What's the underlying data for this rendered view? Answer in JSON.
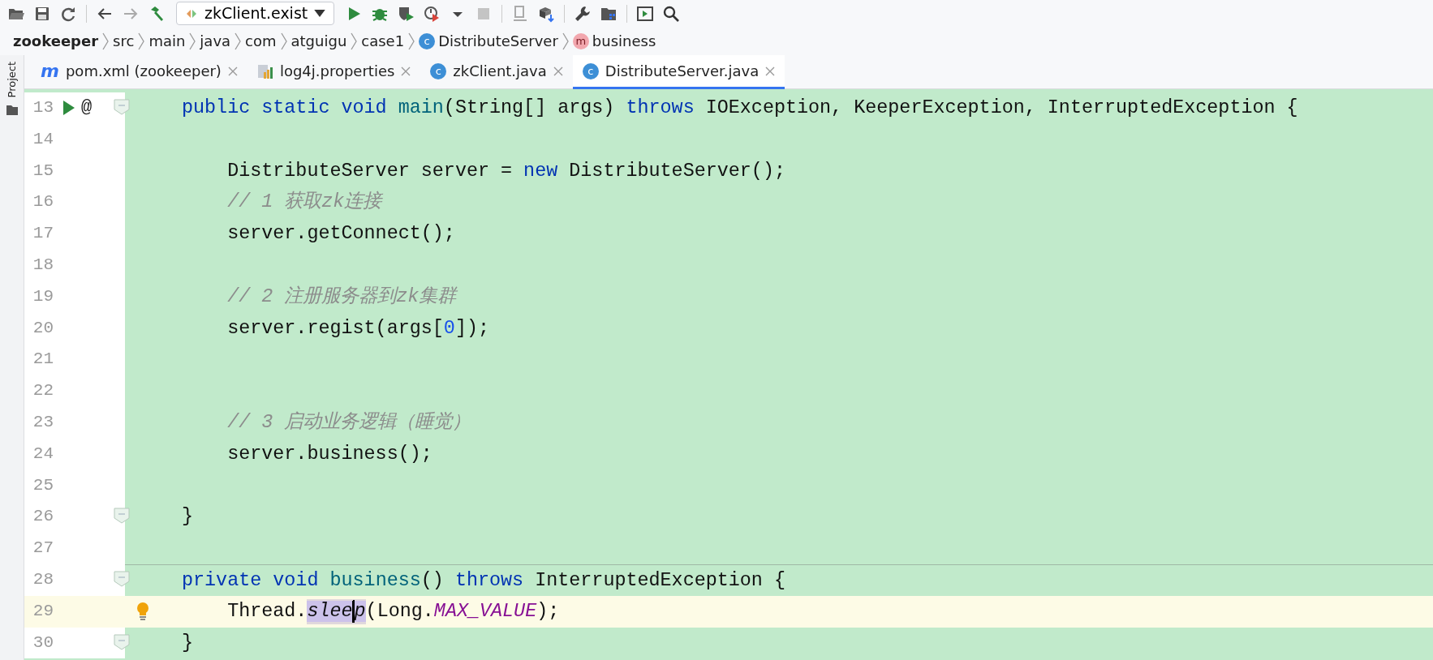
{
  "toolbar": {
    "run_config": "zkClient.exist"
  },
  "breadcrumb": [
    {
      "kind": "module",
      "text": "zookeeper"
    },
    {
      "kind": "dir",
      "text": "src"
    },
    {
      "kind": "dir",
      "text": "main"
    },
    {
      "kind": "dir",
      "text": "java"
    },
    {
      "kind": "dir",
      "text": "com"
    },
    {
      "kind": "dir",
      "text": "atguigu"
    },
    {
      "kind": "dir",
      "text": "case1"
    },
    {
      "kind": "class",
      "badge": "c",
      "text": "DistributeServer"
    },
    {
      "kind": "method",
      "badge": "m",
      "text": "business"
    }
  ],
  "side_tool": {
    "label": "Project"
  },
  "tabs": [
    {
      "kind": "maven",
      "badge": "m",
      "label": "pom.xml (zookeeper)",
      "selected": false
    },
    {
      "kind": "properties",
      "label": "log4j.properties",
      "selected": false
    },
    {
      "kind": "class",
      "badge": "c",
      "label": "zkClient.java",
      "selected": false
    },
    {
      "kind": "class",
      "badge": "c",
      "label": "DistributeServer.java",
      "selected": true
    }
  ],
  "editor": {
    "lines": [
      {
        "number": "13",
        "current": false,
        "separator_above": false,
        "gutter": [
          {
            "kind": "run"
          },
          {
            "kind": "symbol",
            "text": "@"
          },
          {
            "kind": "fold"
          }
        ],
        "tokens": [
          {
            "kind": "keyword",
            "text": "public static void "
          },
          {
            "kind": "method",
            "text": "main"
          },
          {
            "kind": "plain",
            "text": "(String[] args) "
          },
          {
            "kind": "keyword",
            "text": "throws "
          },
          {
            "kind": "plain",
            "text": "IOException, KeeperException, InterruptedException {"
          }
        ]
      },
      {
        "number": "14",
        "current": false,
        "separator_above": false
      },
      {
        "number": "15",
        "current": false,
        "separator_above": false,
        "tokens": [
          {
            "kind": "plain",
            "text": "    DistributeServer server = "
          },
          {
            "kind": "keyword",
            "text": "new "
          },
          {
            "kind": "plain",
            "text": "DistributeServer();"
          }
        ]
      },
      {
        "number": "16",
        "current": false,
        "separator_above": false,
        "tokens": [
          {
            "kind": "comment",
            "text": "    // 1 获取zk连接"
          }
        ]
      },
      {
        "number": "17",
        "current": false,
        "separator_above": false,
        "tokens": [
          {
            "kind": "plain",
            "text": "    server.getConnect();"
          }
        ]
      },
      {
        "number": "18",
        "current": false,
        "separator_above": false
      },
      {
        "number": "19",
        "current": false,
        "separator_above": false,
        "tokens": [
          {
            "kind": "comment",
            "text": "    // 2 注册服务器到zk集群"
          }
        ]
      },
      {
        "number": "20",
        "current": false,
        "separator_above": false,
        "tokens": [
          {
            "kind": "plain",
            "text": "    server.regist(args["
          },
          {
            "kind": "number",
            "text": "0"
          },
          {
            "kind": "plain",
            "text": "]);"
          }
        ]
      },
      {
        "number": "21",
        "current": false,
        "separator_above": false
      },
      {
        "number": "22",
        "current": false,
        "separator_above": false
      },
      {
        "number": "23",
        "current": false,
        "separator_above": false,
        "tokens": [
          {
            "kind": "comment",
            "text": "    // 3 启动业务逻辑（睡觉）"
          }
        ]
      },
      {
        "number": "24",
        "current": false,
        "separator_above": false,
        "tokens": [
          {
            "kind": "plain",
            "text": "    server.business();"
          }
        ]
      },
      {
        "number": "25",
        "current": false,
        "separator_above": false
      },
      {
        "number": "26",
        "current": false,
        "separator_above": false,
        "gutter": [
          {
            "kind": "fold"
          }
        ],
        "tokens": [
          {
            "kind": "plain",
            "text": "}"
          }
        ]
      },
      {
        "number": "27",
        "current": false,
        "separator_above": false
      },
      {
        "number": "28",
        "current": false,
        "separator_above": true,
        "gutter": [
          {
            "kind": "fold"
          }
        ],
        "tokens": [
          {
            "kind": "keyword",
            "text": "private void "
          },
          {
            "kind": "method",
            "text": "business"
          },
          {
            "kind": "plain",
            "text": "() "
          },
          {
            "kind": "keyword",
            "text": "throws "
          },
          {
            "kind": "plain",
            "text": "InterruptedException {"
          }
        ]
      },
      {
        "number": "29",
        "current": true,
        "separator_above": false,
        "gutter": [
          {
            "kind": "bulb"
          }
        ],
        "tokens": [
          {
            "kind": "plain",
            "text": "    Thread."
          },
          {
            "kind": "usage",
            "text": "slee"
          },
          {
            "kind": "caret"
          },
          {
            "kind": "usage",
            "text": "p"
          },
          {
            "kind": "plain",
            "text": "(Long."
          },
          {
            "kind": "constant",
            "text": "MAX_VALUE"
          },
          {
            "kind": "plain",
            "text": ");"
          }
        ]
      },
      {
        "number": "30",
        "current": false,
        "separator_above": false,
        "gutter": [
          {
            "kind": "fold"
          }
        ],
        "tokens": [
          {
            "kind": "plain",
            "text": "}"
          }
        ]
      }
    ]
  }
}
